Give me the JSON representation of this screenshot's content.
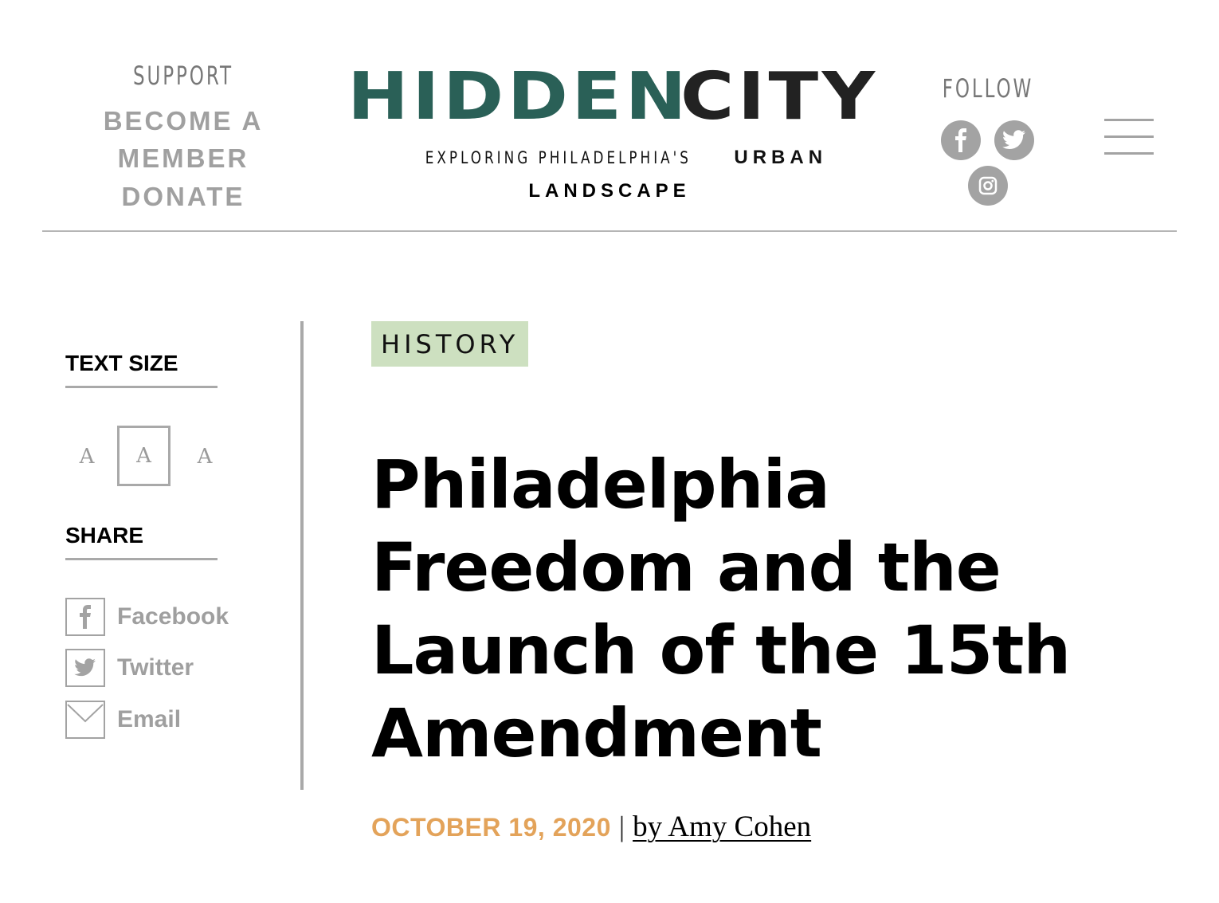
{
  "header": {
    "support": {
      "label": "SUPPORT",
      "links": [
        "BECOME A",
        "MEMBER",
        "DONATE"
      ]
    },
    "logo": {
      "word1": "HIDDEN",
      "word2": "CITY",
      "colors": {
        "word1": "#2a6057",
        "word2": "#222222"
      }
    },
    "tagline": {
      "part1": "EXPLORING PHILADELPHIA'S",
      "part2": "URBAN",
      "part3": "LANDSCAPE"
    },
    "follow": {
      "label": "FOLLOW",
      "icons": [
        "facebook-icon",
        "twitter-icon",
        "instagram-icon"
      ]
    },
    "menu_icon": "hamburger-menu-icon"
  },
  "sidebar": {
    "text_size": {
      "heading": "TEXT SIZE",
      "options": [
        "A",
        "A",
        "A"
      ],
      "selected_index": 1
    },
    "share": {
      "heading": "SHARE",
      "items": [
        {
          "label": "Facebook",
          "icon": "facebook-icon"
        },
        {
          "label": "Twitter",
          "icon": "twitter-icon"
        },
        {
          "label": "Email",
          "icon": "email-icon"
        }
      ]
    }
  },
  "article": {
    "category": "HISTORY",
    "title_lines": [
      "Philadelphia",
      "Freedom and the",
      "Launch of the 15th",
      "Amendment"
    ],
    "date": "OCTOBER 19, 2020",
    "separator": "|",
    "byline": "by Amy Cohen"
  },
  "colors": {
    "accent_green": "#2a6057",
    "category_bg": "#cde0c0",
    "date_orange": "#e3a35a",
    "gray": "#a3a3a3"
  }
}
